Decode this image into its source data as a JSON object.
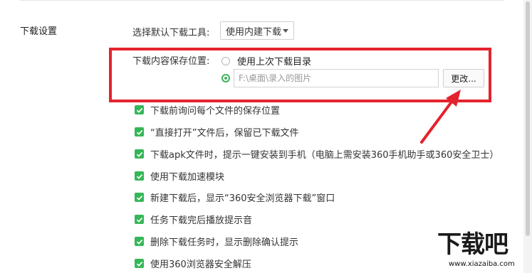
{
  "section": {
    "title": "下载设置"
  },
  "default_tool": {
    "label": "选择默认下载工具:",
    "selected": "使用内建下载"
  },
  "save_location": {
    "label": "下载内容保存位置:",
    "radio_last_dir": "使用上次下载目录",
    "path_value": "F:\\桌面\\录入的图片",
    "change_button": "更改..."
  },
  "options": [
    {
      "text": "下载前询问每个文件的保存位置",
      "checked": true
    },
    {
      "text": "“直接打开”文件后，保留已下载文件",
      "checked": true
    },
    {
      "text": "下载apk文件时，提示一键安装到手机（电脑上需安装360手机助手或360安全卫士）",
      "checked": true
    },
    {
      "text": "使用下载加速模块",
      "checked": true
    },
    {
      "text": "新建下载后，显示“360安全浏览器下载”窗口",
      "checked": true
    },
    {
      "text": "任务下载完后播放提示音",
      "checked": true
    },
    {
      "text": "删除下载任务时，显示删除确认提示",
      "checked": true
    },
    {
      "text": "使用360浏览器安全解压",
      "checked": true
    }
  ],
  "watermark": {
    "logo_text": "下载吧",
    "url": "www.xiazaiba.com"
  },
  "colors": {
    "accent_green": "#35b758",
    "highlight_red": "#e3232c"
  }
}
